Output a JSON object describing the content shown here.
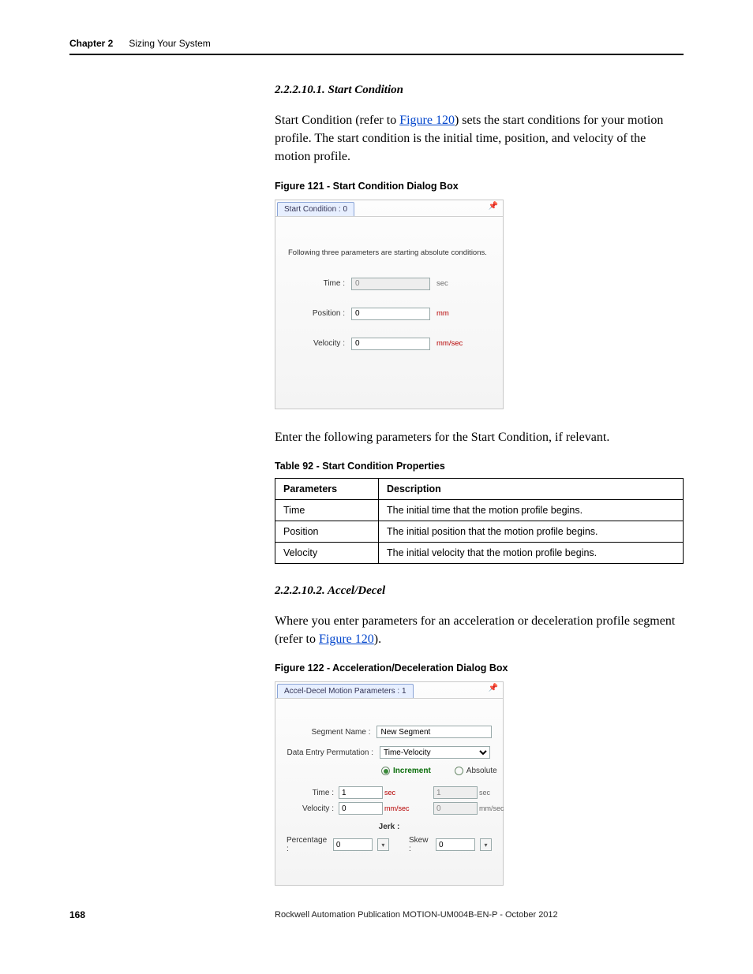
{
  "header": {
    "chapter": "Chapter 2",
    "title": "Sizing Your System"
  },
  "sec1": {
    "numtitle": "2.2.2.10.1.  Start Condition",
    "p1a": "Start Condition (refer to ",
    "p1link": "Figure 120",
    "p1b": ") sets the start conditions for your motion profile. The start condition is the initial time, position, and velocity of the motion profile.",
    "figcap": "Figure 121 - Start Condition Dialog Box",
    "dlg": {
      "tab": "Start Condition : 0",
      "note": "Following three parameters are starting absolute conditions.",
      "time_lbl": "Time :",
      "time_val": "0",
      "time_unit": "sec",
      "pos_lbl": "Position :",
      "pos_val": "0",
      "pos_unit": "mm",
      "vel_lbl": "Velocity :",
      "vel_val": "0",
      "vel_unit": "mm/sec"
    },
    "p2": "Enter the following parameters for the Start Condition, if relevant.",
    "tablecap": "Table 92 - Start Condition Properties",
    "table": {
      "h1": "Parameters",
      "h2": "Description",
      "r1c1": "Time",
      "r1c2": "The initial time that the motion profile begins.",
      "r2c1": "Position",
      "r2c2": "The initial position that the motion profile begins.",
      "r3c1": "Velocity",
      "r3c2": "The initial velocity that the motion profile begins."
    }
  },
  "sec2": {
    "numtitle": "2.2.2.10.2.  Accel/Decel",
    "p1a": "Where you enter parameters for an acceleration or deceleration profile segment (refer to ",
    "p1link": "Figure 120",
    "p1b": ").",
    "figcap": "Figure 122 - Acceleration/Deceleration Dialog Box",
    "dlg": {
      "tab": "Accel-Decel Motion Parameters : 1",
      "segname_lbl": "Segment Name :",
      "segname_val": "New Segment",
      "perm_lbl": "Data Entry Permutation :",
      "perm_val": "Time-Velocity",
      "radio_inc": "Increment",
      "radio_abs": "Absolute",
      "time_lbl": "Time :",
      "time_v1": "1",
      "time_u1": "sec",
      "time_v2": "1",
      "time_u2": "sec",
      "vel_lbl": "Velocity :",
      "vel_v1": "0",
      "vel_u1": "mm/sec",
      "vel_v2": "0",
      "vel_u2": "mm/sec",
      "jerk_lbl": "Jerk :",
      "pct_lbl": "Percentage :",
      "pct_val": "0",
      "skew_lbl": "Skew :",
      "skew_val": "0"
    }
  },
  "footer": {
    "page": "168",
    "pub": "Rockwell Automation Publication MOTION-UM004B-EN-P - October 2012"
  }
}
